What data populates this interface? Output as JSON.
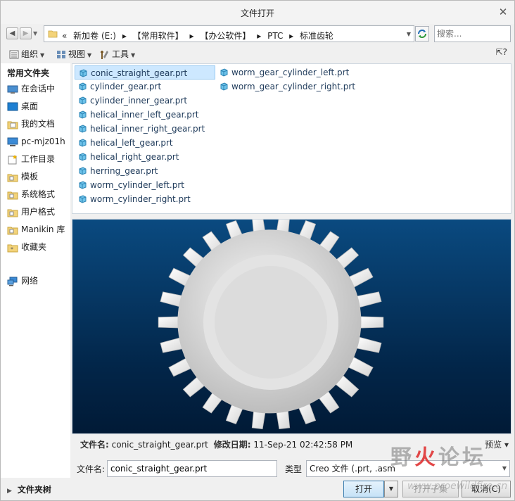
{
  "window": {
    "title": "文件打开",
    "close": "✕"
  },
  "nav": {
    "back": "◀",
    "forward": "▶",
    "dropdown": "▼",
    "breadcrumb": [
      "«",
      "新加卷 (E:)",
      "▸",
      "【常用软件】",
      "▸",
      "【办公软件】",
      "▸",
      "PTC",
      "▸",
      "标准齿轮"
    ],
    "search_placeholder": "搜索..."
  },
  "toolbar": {
    "organize": "组织",
    "view": "视图",
    "tools": "工具",
    "help": "?"
  },
  "sidebar": {
    "heading": "常用文件夹",
    "items": [
      {
        "label": "在会话中",
        "icon": "session-icon"
      },
      {
        "label": "桌面",
        "icon": "desktop-icon"
      },
      {
        "label": "我的文档",
        "icon": "documents-icon"
      },
      {
        "label": "pc-mjz01h",
        "icon": "computer-icon"
      },
      {
        "label": "工作目录",
        "icon": "working-directory-icon"
      },
      {
        "label": "模板",
        "icon": "folder-icon"
      },
      {
        "label": "系统格式",
        "icon": "folder-icon"
      },
      {
        "label": "用户格式",
        "icon": "folder-icon"
      },
      {
        "label": "Manikin 库",
        "icon": "folder-icon"
      },
      {
        "label": "收藏夹",
        "icon": "favorites-icon"
      },
      {
        "label": "网络",
        "icon": "network-icon"
      }
    ]
  },
  "files": [
    {
      "name": "conic_straight_gear.prt",
      "selected": true
    },
    {
      "name": "cylinder_gear.prt"
    },
    {
      "name": "cylinder_inner_gear.prt"
    },
    {
      "name": "helical_inner_left_gear.prt"
    },
    {
      "name": "helical_inner_right_gear.prt"
    },
    {
      "name": "helical_left_gear.prt"
    },
    {
      "name": "helical_right_gear.prt"
    },
    {
      "name": "herring_gear.prt"
    },
    {
      "name": "worm_cylinder_left.prt"
    },
    {
      "name": "worm_cylinder_right.prt"
    },
    {
      "name": "worm_gear_cylinder_left.prt"
    },
    {
      "name": "worm_gear_cylinder_right.prt"
    }
  ],
  "info": {
    "filename_label": "文件名:",
    "filename": "conic_straight_gear.prt",
    "modified_label": "修改日期:",
    "modified": "11-Sep-21 02:42:58 PM",
    "preview_toggle": "预览 ▾"
  },
  "form": {
    "filename_label": "文件名:",
    "filename_value": "conic_straight_gear.prt",
    "type_label": "类型",
    "type_value": "Creo 文件 (.prt, .asm"
  },
  "buttons": {
    "tree": "文件夹树",
    "open": "打开",
    "open_dd": "▼",
    "mid": "打开子集",
    "cancel": "取消(C)"
  },
  "watermark": {
    "left": "野",
    "red": "火",
    "right": "论坛",
    "url": "www.proewildfire.cn"
  },
  "colors": {
    "selected_bg": "#cde8ff",
    "preview_top": "#0a4a80",
    "preview_bottom": "#011a36",
    "link": "#1b6bb6"
  }
}
